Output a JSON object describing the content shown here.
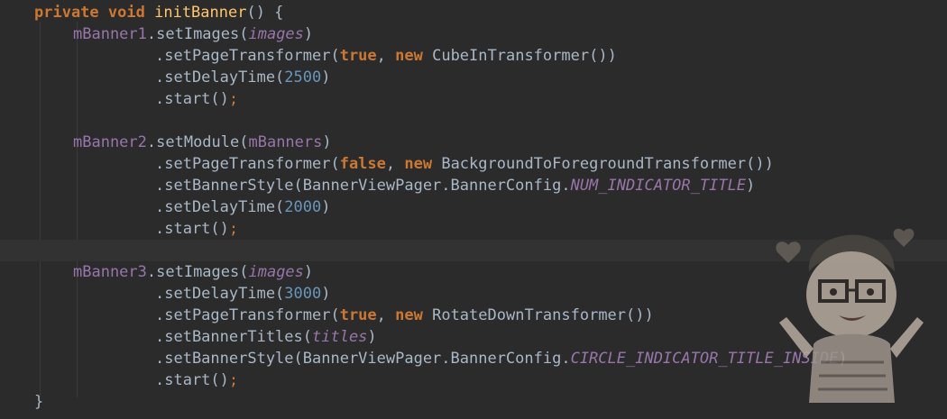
{
  "code": {
    "header": {
      "modifier": "private",
      "type": "void",
      "name": "initBanner",
      "tail": "() {"
    },
    "block1": {
      "recv": "mBanner1",
      "m1": ".setImages(",
      "a1": "images",
      "c1": ")",
      "m2": ".setPageTransformer(",
      "b2": "true",
      "comma2": ", ",
      "new2": "new",
      "cls2": " CubeInTransformer",
      "c2": "())",
      "m3": ".setDelayTime(",
      "n3": "2500",
      "c3": ")",
      "m4": ".start()",
      "s4": ";"
    },
    "block2": {
      "recv": "mBanner2",
      "m1": ".setModule(",
      "a1": "mBanners",
      "c1": ")",
      "m2": ".setPageTransformer(",
      "b2": "false",
      "comma2": ", ",
      "new2": "new",
      "cls2": " BackgroundToForegroundTransformer",
      "c2": "())",
      "m3": ".setBannerStyle(",
      "q3": "BannerViewPager.BannerConfig.",
      "e3": "NUM_INDICATOR_TITLE",
      "c3": ")",
      "m4": ".setDelayTime(",
      "n4": "2000",
      "c4": ")",
      "m5": ".start()",
      "s5": ";"
    },
    "block3": {
      "recv": "mBanner3",
      "m1": ".setImages(",
      "a1": "images",
      "c1": ")",
      "m2": ".setDelayTime(",
      "n2": "3000",
      "c2": ")",
      "m3": ".setPageTransformer(",
      "b3": "true",
      "comma3": ", ",
      "new3": "new",
      "cls3": " RotateDownTransformer",
      "c3": "())",
      "m4": ".setBannerTitles(",
      "a4": "titles",
      "c4": ")",
      "m5": ".setBannerStyle(",
      "q5": "BannerViewPager.BannerConfig.",
      "e5": "CIRCLE_INDICATOR_TITLE_INSIDE",
      "c5": ")",
      "m6": ".start()",
      "s6": ";"
    },
    "closing": "}"
  },
  "colors": {
    "background": "#2b2b2b",
    "keyword": "#cc7832",
    "method_decl": "#ffc66d",
    "field": "#9876aa",
    "number": "#6897bb",
    "plain": "#a9b7c6"
  },
  "mascot": {
    "icon": "cartoon-mascot-sticker"
  }
}
